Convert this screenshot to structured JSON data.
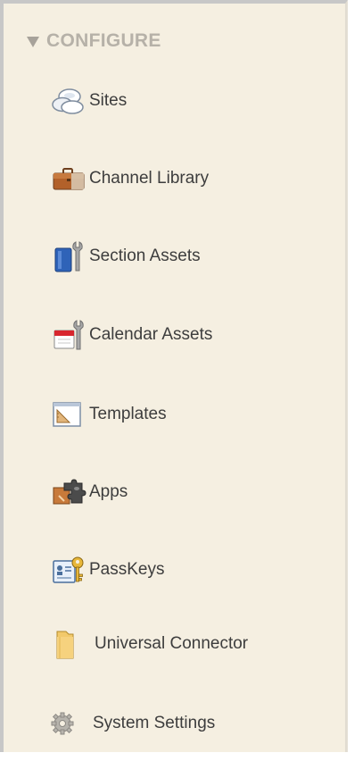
{
  "section": {
    "title": "CONFIGURE",
    "caret_icon": "triangle-down-icon"
  },
  "items": [
    {
      "label": "Sites",
      "icon": "clouds-icon"
    },
    {
      "label": "Channel Library",
      "icon": "briefcase-icon"
    },
    {
      "label": "Section Assets",
      "icon": "section-wrench-icon"
    },
    {
      "label": "Calendar Assets",
      "icon": "calendar-wrench-icon"
    },
    {
      "label": "Templates",
      "icon": "template-icon"
    },
    {
      "label": "Apps",
      "icon": "puzzle-icon"
    },
    {
      "label": "PassKeys",
      "icon": "passkey-icon"
    },
    {
      "label": "Universal Connector",
      "icon": "folder-icon"
    },
    {
      "label": "System Settings",
      "icon": "gear-icon"
    }
  ],
  "colors": {
    "panel_background": "#f5efe1",
    "header_text": "#b6b1a8",
    "item_text": "#3d3d3d"
  }
}
